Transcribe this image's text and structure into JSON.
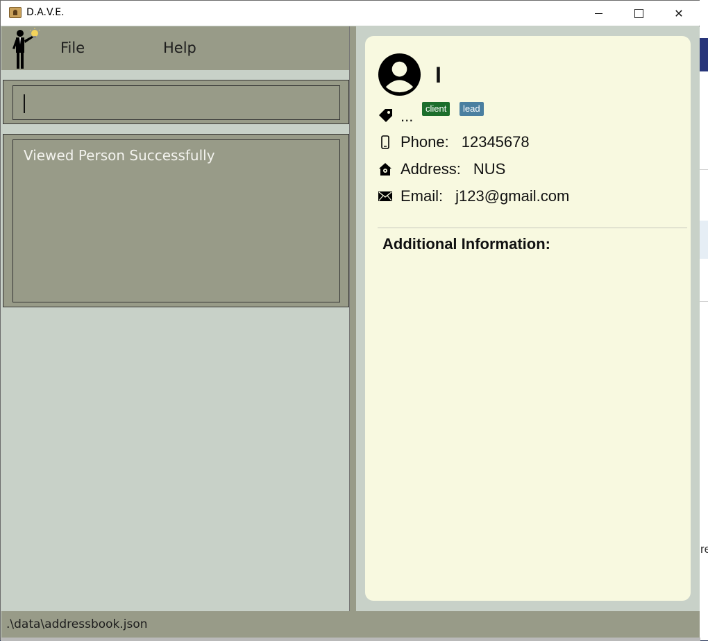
{
  "window": {
    "title": "D.A.V.E.",
    "controls": {
      "minimize_icon": "minimize-icon",
      "maximize_icon": "maximize-icon",
      "close_icon": "close-icon",
      "close_glyph": "✕"
    }
  },
  "menubar": {
    "items": [
      {
        "label": "File"
      },
      {
        "label": "Help"
      }
    ]
  },
  "command": {
    "value": ""
  },
  "result": {
    "message": "Viewed Person Successfully"
  },
  "person": {
    "name": "I",
    "tags_ellipsis": "...",
    "tags": [
      {
        "label": "client",
        "color": "#1c6e2b"
      },
      {
        "label": "lead",
        "color": "#4a7fa0"
      }
    ],
    "phone": {
      "label": "Phone:",
      "value": "12345678"
    },
    "address": {
      "label": "Address:",
      "value": "NUS"
    },
    "email": {
      "label": "Email:",
      "value": "j123@gmail.com"
    },
    "additional_info_heading": "Additional Information:"
  },
  "statusbar": {
    "path": ".\\data\\addressbook.json"
  },
  "background": {
    "partial_text": "re"
  },
  "colors": {
    "panel": "#989b88",
    "background": "#c8d1c8",
    "card": "#f8f9e0"
  }
}
